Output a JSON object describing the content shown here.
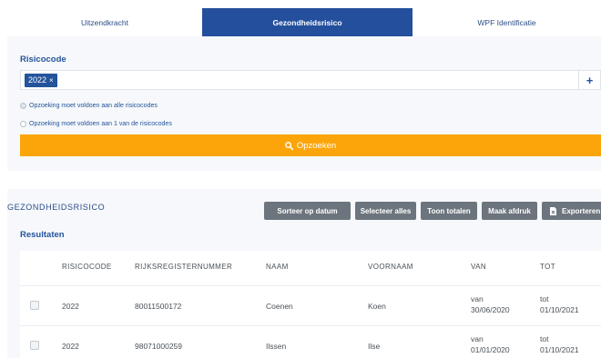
{
  "tabs": [
    {
      "label": "Uitzendkracht",
      "active": false
    },
    {
      "label": "Gezondheidsrisico",
      "active": true
    },
    {
      "label": "WPF Identificatie",
      "active": false
    }
  ],
  "search": {
    "title": "Risicocode",
    "tag": "2022",
    "tag_remove": "×",
    "input_value": "",
    "input_placeholder": "",
    "add_label": "+",
    "options": [
      {
        "label": "Opzoeking moet voldoen aan alle risicocodes",
        "selected": true
      },
      {
        "label": "Opzoeking moet voldoen aan 1 van de risicocodes",
        "selected": false
      }
    ],
    "button_label": "Opzoeken"
  },
  "results": {
    "title": "GEZONDHEIDSRISICO",
    "subtitle": "Resultaten",
    "buttons": {
      "sort": "Sorteer op datum",
      "select_all": "Selecteer alles",
      "totals": "Toon totalen",
      "print": "Maak afdruk",
      "export": "Exporteren"
    },
    "columns": [
      "RISICOCODE",
      "RIJKSREGISTERNUMMER",
      "NAAM",
      "VOORNAAM",
      "VAN",
      "TOT"
    ],
    "rows": [
      {
        "code": "2022",
        "register": "80011500172",
        "naam": "Coenen",
        "voornaam": "Koen",
        "van_prefix": "van",
        "van_date": "30/06/2020",
        "tot_prefix": "tot",
        "tot_date": "01/10/2021"
      },
      {
        "code": "2022",
        "register": "98071000259",
        "naam": "Ilssen",
        "voornaam": "Ilse",
        "van_prefix": "van",
        "van_date": "01/01/2020",
        "tot_prefix": "tot",
        "tot_date": "01/10/2021"
      }
    ]
  },
  "colors": {
    "primary": "#244f9c",
    "accent_orange": "#fca50a",
    "button_gray": "#6c757d",
    "panel_bg": "#f6f8fb"
  },
  "icons": {
    "search_button": "search-icon",
    "export_button": "file-export-icon",
    "add": "plus-icon",
    "tag_remove": "close-icon"
  }
}
